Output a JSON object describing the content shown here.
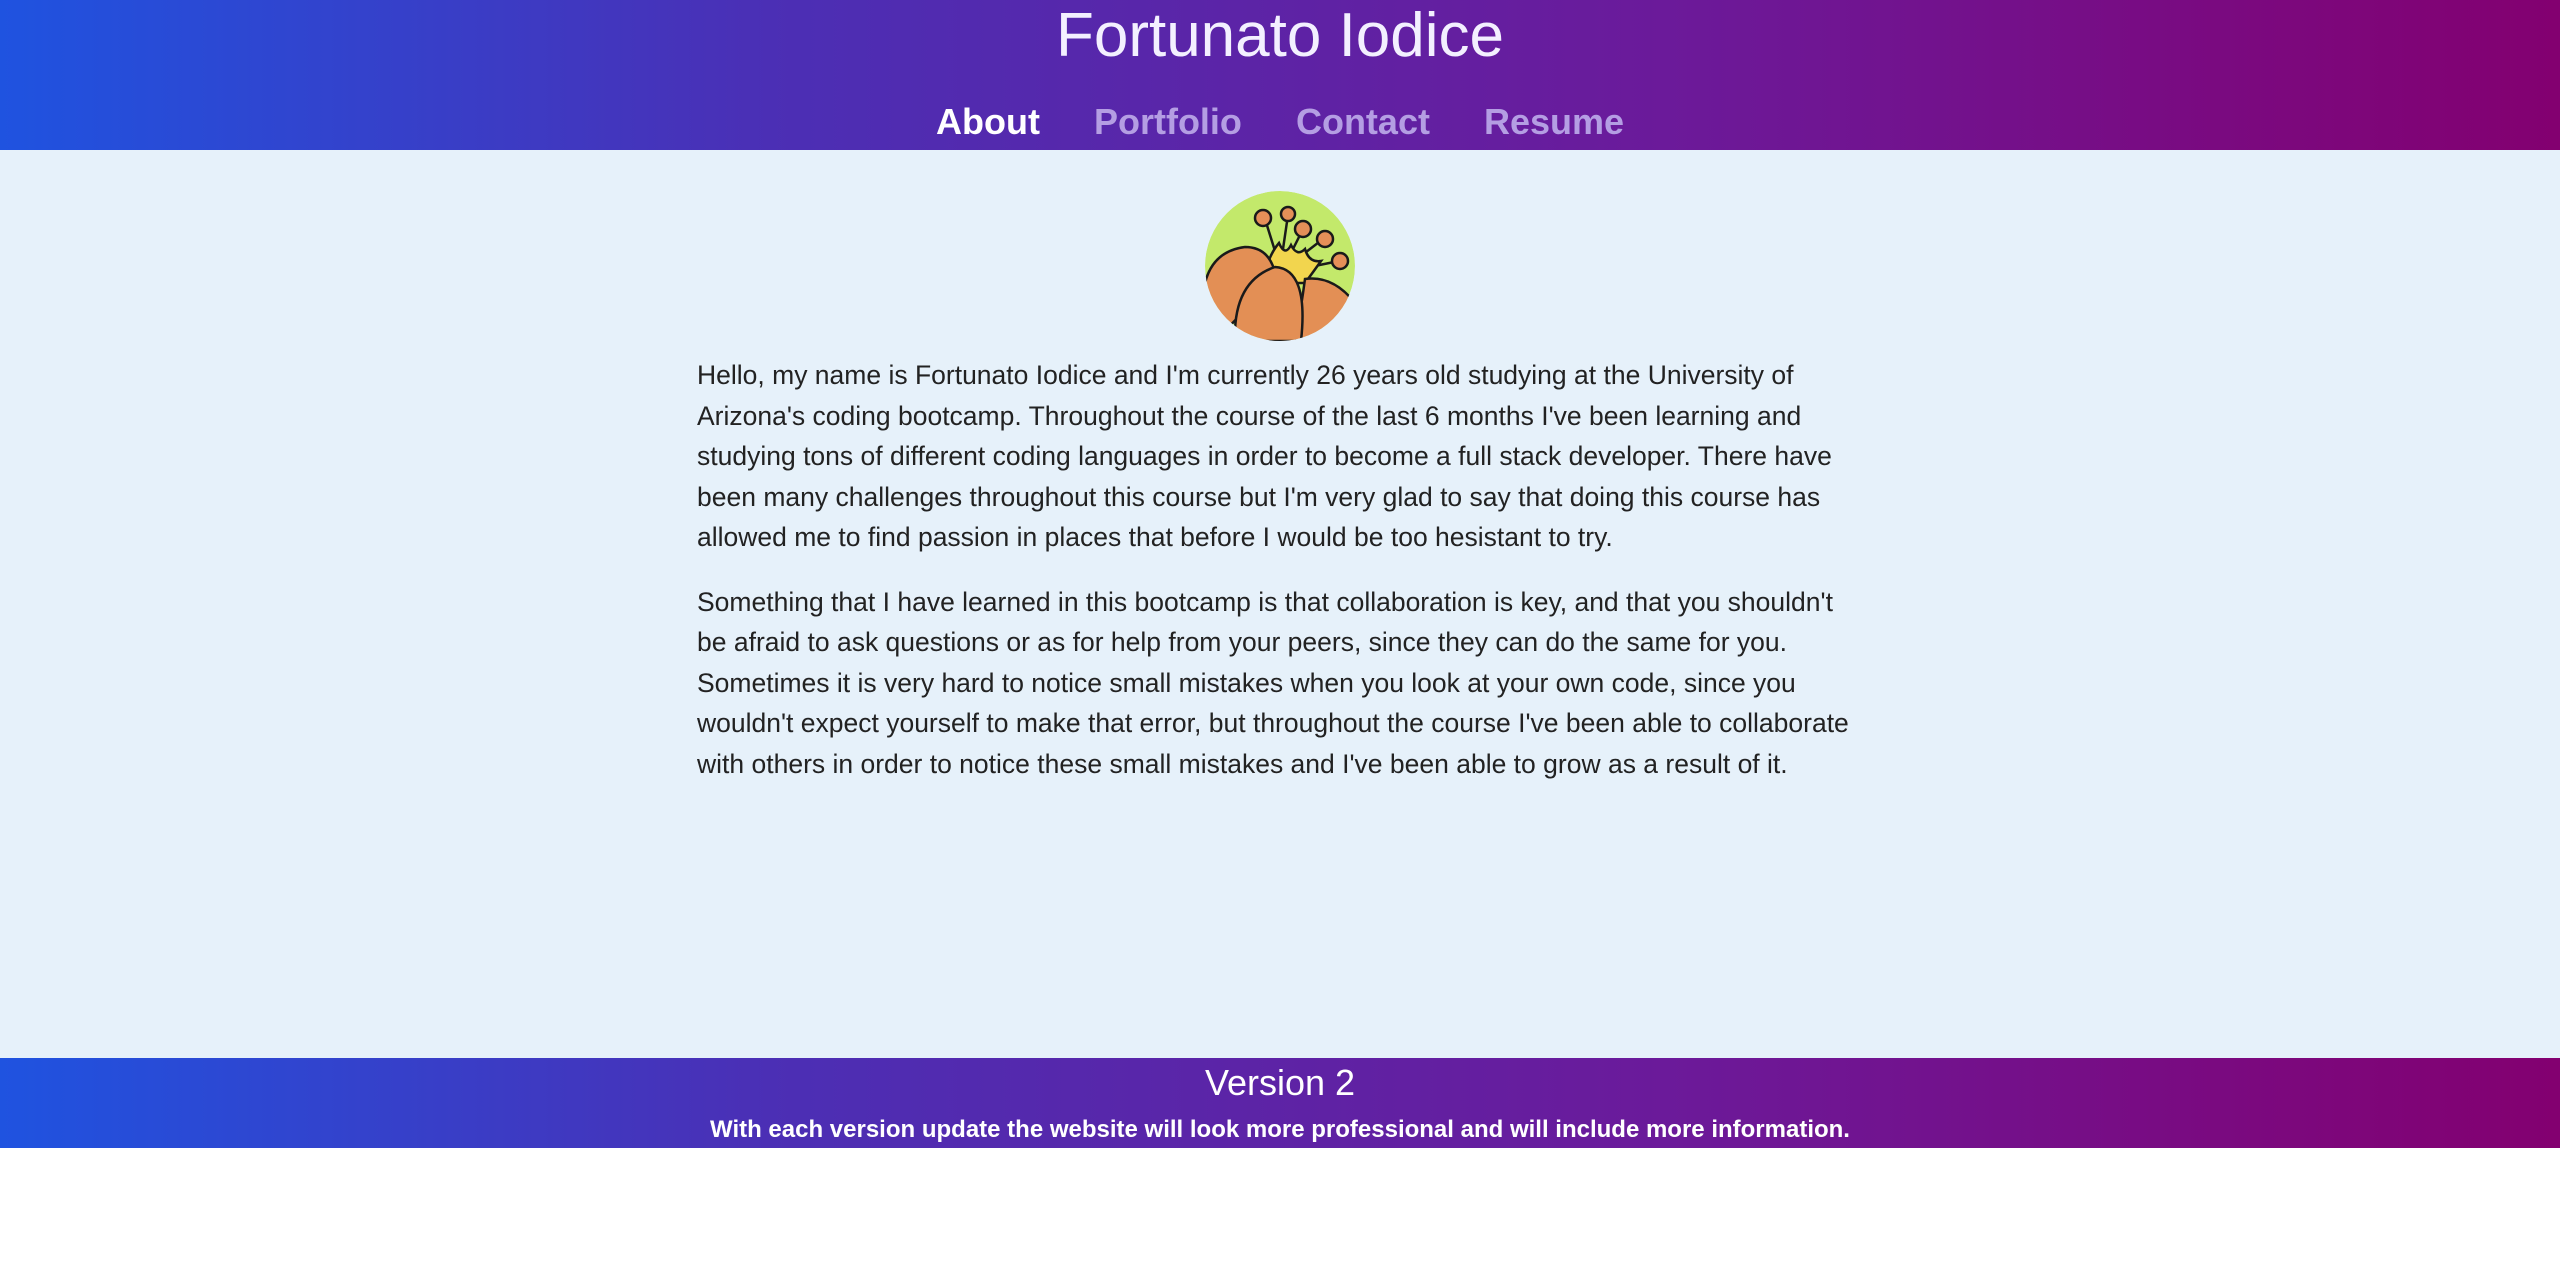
{
  "header": {
    "title": "Fortunato Iodice",
    "nav": [
      {
        "label": "About",
        "active": true
      },
      {
        "label": "Portfolio",
        "active": false
      },
      {
        "label": "Contact",
        "active": false
      },
      {
        "label": "Resume",
        "active": false
      }
    ]
  },
  "main": {
    "avatar_icon": "flower-avatar-icon",
    "paragraphs": [
      "Hello, my name is Fortunato Iodice and I'm currently 26 years old studying at the University of Arizona's coding bootcamp. Throughout the course of the last 6 months I've been learning and studying tons of different coding languages in order to become a full stack developer. There have been many challenges throughout this course but I'm very glad to say that doing this course has allowed me to find passion in places that before I would be too hesistant to try.",
      "Something that I have learned in this bootcamp is that collaboration is key, and that you shouldn't be afraid to ask questions or as for help from your peers, since they can do the same for you. Sometimes it is very hard to notice small mistakes when you look at your own code, since you wouldn't expect yourself to make that error, but throughout the course I've been able to collaborate with others in order to notice these small mistakes and I've been able to grow as a result of it."
    ]
  },
  "footer": {
    "version": "Version 2",
    "note": "With each version update the website will look more professional and will include more information."
  },
  "colors": {
    "gradient_start": "#1f53e0",
    "gradient_end": "#830070",
    "main_background": "#e6f1fa",
    "nav_inactive": "#b49ee3",
    "nav_active": "#ffffff"
  }
}
